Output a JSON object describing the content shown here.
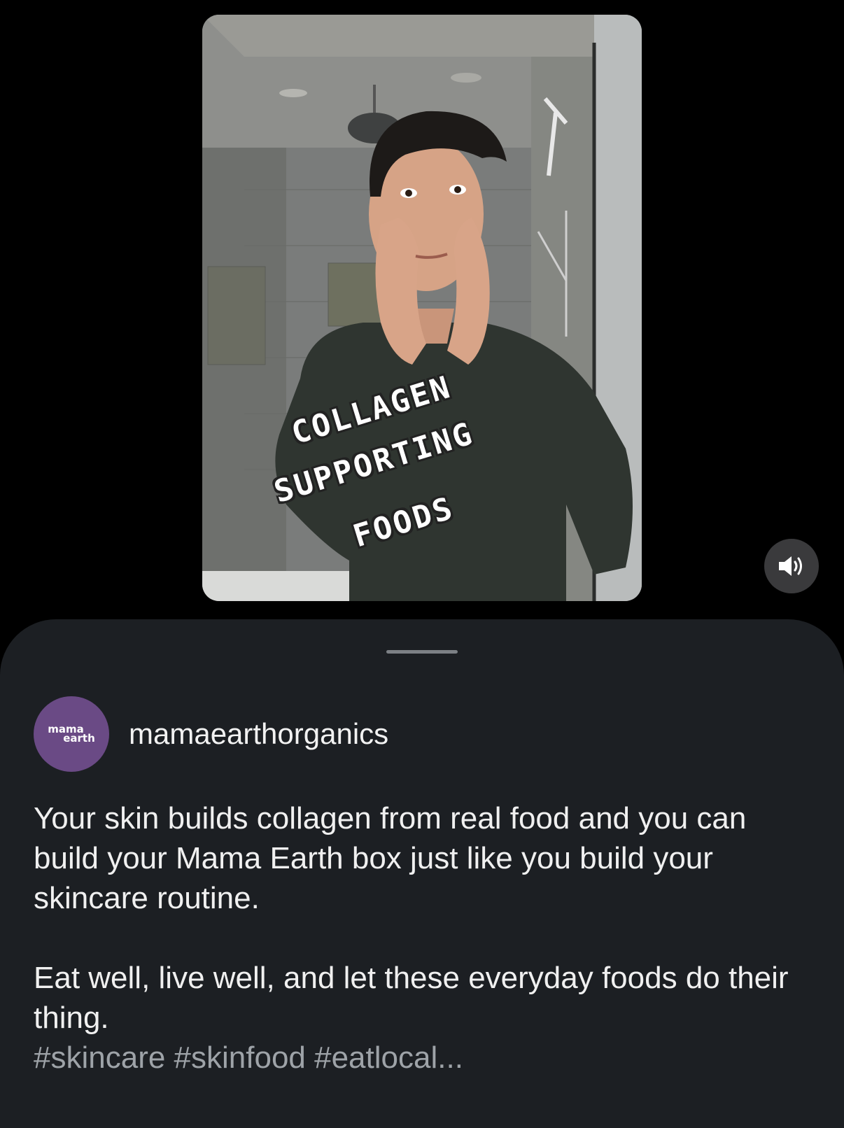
{
  "video": {
    "overlay_lines": [
      "COLLAGEN",
      "SUPPORTING",
      "FOODS"
    ]
  },
  "controls": {
    "mute_icon": "speaker-icon"
  },
  "post": {
    "avatar_lines": [
      "mama",
      "earth"
    ],
    "username": "mamaearthorganics",
    "caption_p1": "Your skin builds collagen from real food and you can build your Mama Earth box just like you build your skincare routine.",
    "caption_p2": "Eat well, live well, and let these everyday foods do their thing.",
    "hashtags": "#skincare #skinfood #eatlocal..."
  },
  "colors": {
    "background": "#000000",
    "sheet": "#1c1f23",
    "avatar": "#6a4a85",
    "hashtag": "#9ea3a8"
  }
}
